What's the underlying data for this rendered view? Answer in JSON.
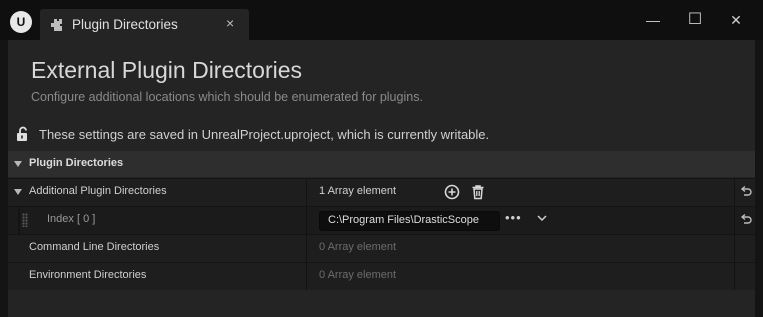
{
  "window": {
    "tab_title": "Plugin Directories",
    "tab_close": "×",
    "controls": {
      "minimize": "—",
      "maximize": "☐",
      "close": "✕"
    }
  },
  "header": {
    "title": "External Plugin Directories",
    "subtitle": "Configure additional locations which should be enumerated for plugins."
  },
  "status": {
    "text": "These settings are saved in UnrealProject.uproject, which is currently writable."
  },
  "category": {
    "label": "Plugin Directories"
  },
  "properties": {
    "additional": {
      "label": "Additional Plugin Directories",
      "value": "1 Array element"
    },
    "index0": {
      "label": "Index [ 0 ]",
      "value": "C:\\Program Files\\DrasticScope",
      "more": "•••"
    },
    "command_line": {
      "label": "Command Line Directories",
      "value": "0 Array element"
    },
    "environment": {
      "label": "Environment Directories",
      "value": "0 Array element"
    }
  },
  "colors": {
    "background": "#242424",
    "titlebar": "#0f0f0f",
    "text": "#d0d0d0",
    "dim_text": "#6c6c6c"
  }
}
